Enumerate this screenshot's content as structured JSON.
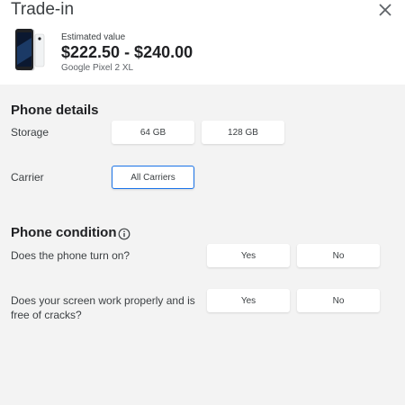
{
  "header": {
    "title": "Trade-in",
    "estimated_label": "Estimated value",
    "price_range": "$222.50 - $240.00",
    "model": "Google Pixel 2 XL"
  },
  "phone_details": {
    "title": "Phone details",
    "storage": {
      "label": "Storage",
      "options": [
        "64 GB",
        "128 GB"
      ]
    },
    "carrier": {
      "label": "Carrier",
      "selected": "All Carriers"
    }
  },
  "phone_condition": {
    "title": "Phone condition",
    "questions": [
      {
        "label": "Does the phone turn on?",
        "yes": "Yes",
        "no": "No"
      },
      {
        "label": "Does your screen work properly and is free of cracks?",
        "yes": "Yes",
        "no": "No"
      }
    ]
  },
  "colors": {
    "accent": "#1a73e8",
    "panel_bg": "#f3f3f3"
  }
}
